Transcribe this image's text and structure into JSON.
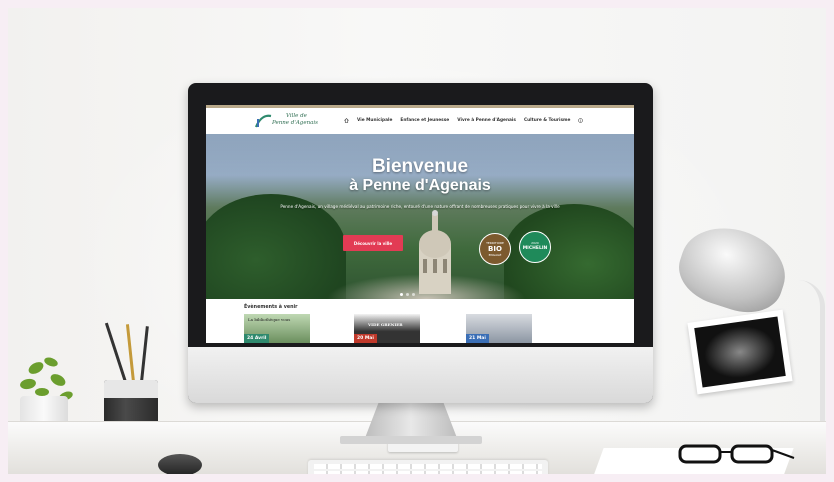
{
  "site": {
    "logo": {
      "line1": "Ville de",
      "line2": "Penne d'Agenais"
    },
    "nav": {
      "items": [
        {
          "label": "Vie Municipale"
        },
        {
          "label": "Enfance et Jeunesse"
        },
        {
          "label": "Vivre à Penne d'Agenais"
        },
        {
          "label": "Culture & Tourisme"
        }
      ]
    },
    "hero": {
      "title_line1": "Bienvenue",
      "title_line2": "à Penne d'Agenais",
      "subtitle": "Penne d'Agenais, un village médiéval au patrimoine riche, entouré d'une nature offrant de nombreuses pratiques pour vivre à la ville",
      "cta_label": "Découvrir la ville",
      "badge_bio": {
        "top": "TERRITOIRE",
        "main": "BIO",
        "bottom": "ENGAGÉ"
      },
      "badge_michelin": {
        "top": "2020",
        "main": "MICHELIN"
      }
    },
    "events": {
      "title": "Évènements à venir",
      "items": [
        {
          "date": "24 Avril",
          "image_text": "La bibliothèque vous"
        },
        {
          "date": "20 Mai",
          "image_text": "VIDE GRENIER"
        },
        {
          "date": "21 Mai",
          "image_text": ""
        }
      ]
    }
  },
  "colors": {
    "accent": "#e23b54",
    "logo_green": "#2f6e52",
    "event_green": "#2f8a6e"
  }
}
